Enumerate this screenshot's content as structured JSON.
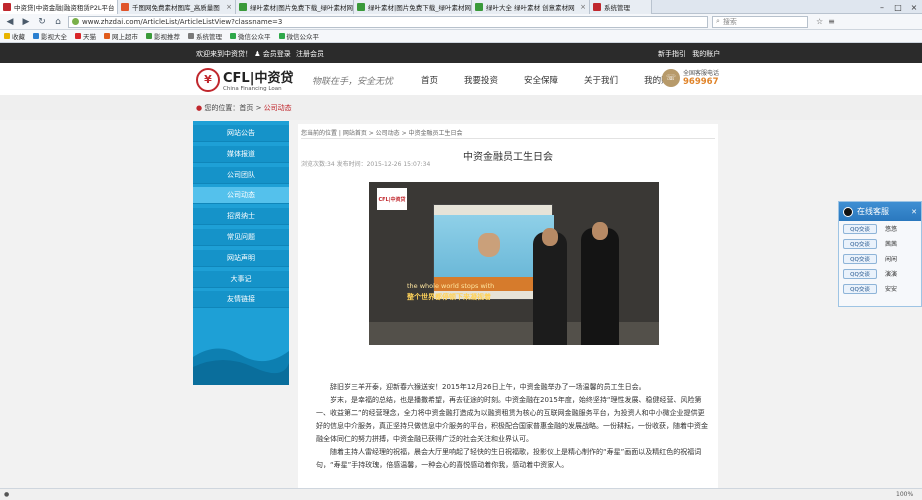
{
  "browser": {
    "tabs": [
      {
        "label": "中资贷|中资金融|融资租赁P2L平台",
        "active": true,
        "color": "#c0272d"
      },
      {
        "label": "千图网免费素材图库_高质量图",
        "active": false,
        "color": "#e0542a"
      },
      {
        "label": "绿叶素材|图片免费下载_绿叶素材网",
        "active": false,
        "color": "#3a9a3a"
      },
      {
        "label": "绿叶素材|图片免费下载_绿叶素材网",
        "active": false,
        "color": "#3a9a3a"
      },
      {
        "label": "绿叶大全 绿叶素材 创意素材网",
        "active": false,
        "color": "#3a9a3a"
      },
      {
        "label": "系统管理",
        "active": false,
        "color": "#c0272d"
      }
    ],
    "url": "www.zhzdai.com/ArticleList/ArticleListView?classname=3",
    "search_placeholder": "搜索",
    "favorites": [
      "收藏",
      "影视大全",
      "天猫",
      "网上超市",
      "影视推荐",
      "系统管理",
      "微信公众平",
      "微信公众平"
    ]
  },
  "topstrip": {
    "welcome": "欢迎来到中资贷！",
    "login": "会员登录",
    "register": "注册会员",
    "guide": "新手指引",
    "account": "我的账户"
  },
  "header": {
    "logo_text": "CFL|中资贷",
    "logo_sub": "China Financing Loan",
    "slogan": "物联在手，安全无忧",
    "nav": [
      "首页",
      "我要投资",
      "安全保障",
      "关于我们",
      "我的账户"
    ],
    "hotline_label": "全国客服电话",
    "hotline_number": "969967"
  },
  "breadcrumb": {
    "prefix": "您的位置：",
    "home": "首页",
    "sep": " > ",
    "current": "公司动态"
  },
  "sidebar": {
    "items": [
      "网站公告",
      "媒体报道",
      "公司团队",
      "公司动态",
      "招贤纳士",
      "常见问题",
      "网站声明",
      "大事记",
      "友情链接"
    ],
    "active_index": 3
  },
  "article": {
    "sub_crumb": "您当前的位置 | 网站首页 > 公司动态 > 中资金融员工生日会",
    "title": "中资金融员工生日会",
    "meta": "浏览次数:34  发布时间：2015-12-26 15:07:34",
    "photo_caption1": "the whole world stops with",
    "photo_caption2": "整个世界都停顿下来凝视着",
    "photo_logo": "CFL|中资贷",
    "paragraphs": [
      "辞旧岁三羊开泰，迎新春六猴送安！2015年12月26日上午，中资金融举办了一场温馨的员工生日会。",
      "岁末，是幸福的总结，也是播撒希望，再去征途的时刻。中资金融在2015年度，始终坚持“理性发展、稳健经营、风险第一、收益第二”的经营理念，全力将中资金融打造成为以融资租赁为核心的互联网金融服务平台，为投资人和中小微企业提供更好的信息中介服务，真正坚持只做信息中介服务的平台，积极配合国家普惠金融的发展战略。一份耕耘，一份收获，随着中资金融全体同仁的努力拼搏，中资金融已获得广泛的社会关注和业界认可。",
      "随着主持人雷经理的祝福，晨会大厅里响起了轻快的生日祝福歌，投影仪上是精心制作的“寿星”画面以及精红色的祝福词句，“寿星”手持玫瑰，倍感温馨，一种会心的喜悦感动着你我，感动着中资家人。"
    ]
  },
  "qq_widget": {
    "title": "在线客服",
    "button_label": "QQ交谈",
    "agents": [
      "悠悠",
      "茜茜",
      "闲闲",
      "演演",
      "安安"
    ]
  },
  "statusbar": {
    "zoom": "100%"
  }
}
